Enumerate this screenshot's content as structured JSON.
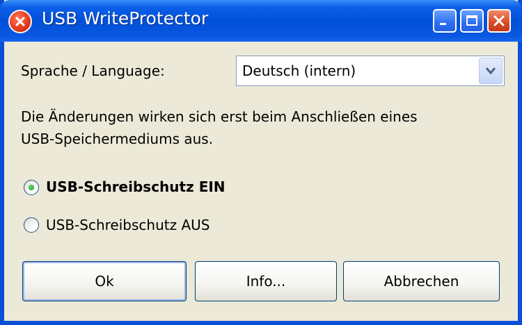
{
  "window": {
    "title": "USB WriteProtector",
    "icon": "app-error-icon",
    "controls": [
      "minimize-icon",
      "maximize-icon",
      "close-icon"
    ]
  },
  "language": {
    "label": "Sprache / Language:",
    "selected": "Deutsch (intern)"
  },
  "info_text": {
    "line1": "Die Änderungen wirken sich erst beim Anschließen eines",
    "line2": "USB-Speichermediums aus."
  },
  "options": [
    {
      "label": "USB-Schreibschutz EIN",
      "checked": true
    },
    {
      "label": "USB-Schreibschutz AUS",
      "checked": false
    }
  ],
  "buttons": {
    "ok": "Ok",
    "info": "Info...",
    "cancel": "Abbrechen"
  },
  "colors": {
    "titlebar": "#0a56e0",
    "window_bg": "#ece9d8",
    "close_button": "#d84a26"
  }
}
